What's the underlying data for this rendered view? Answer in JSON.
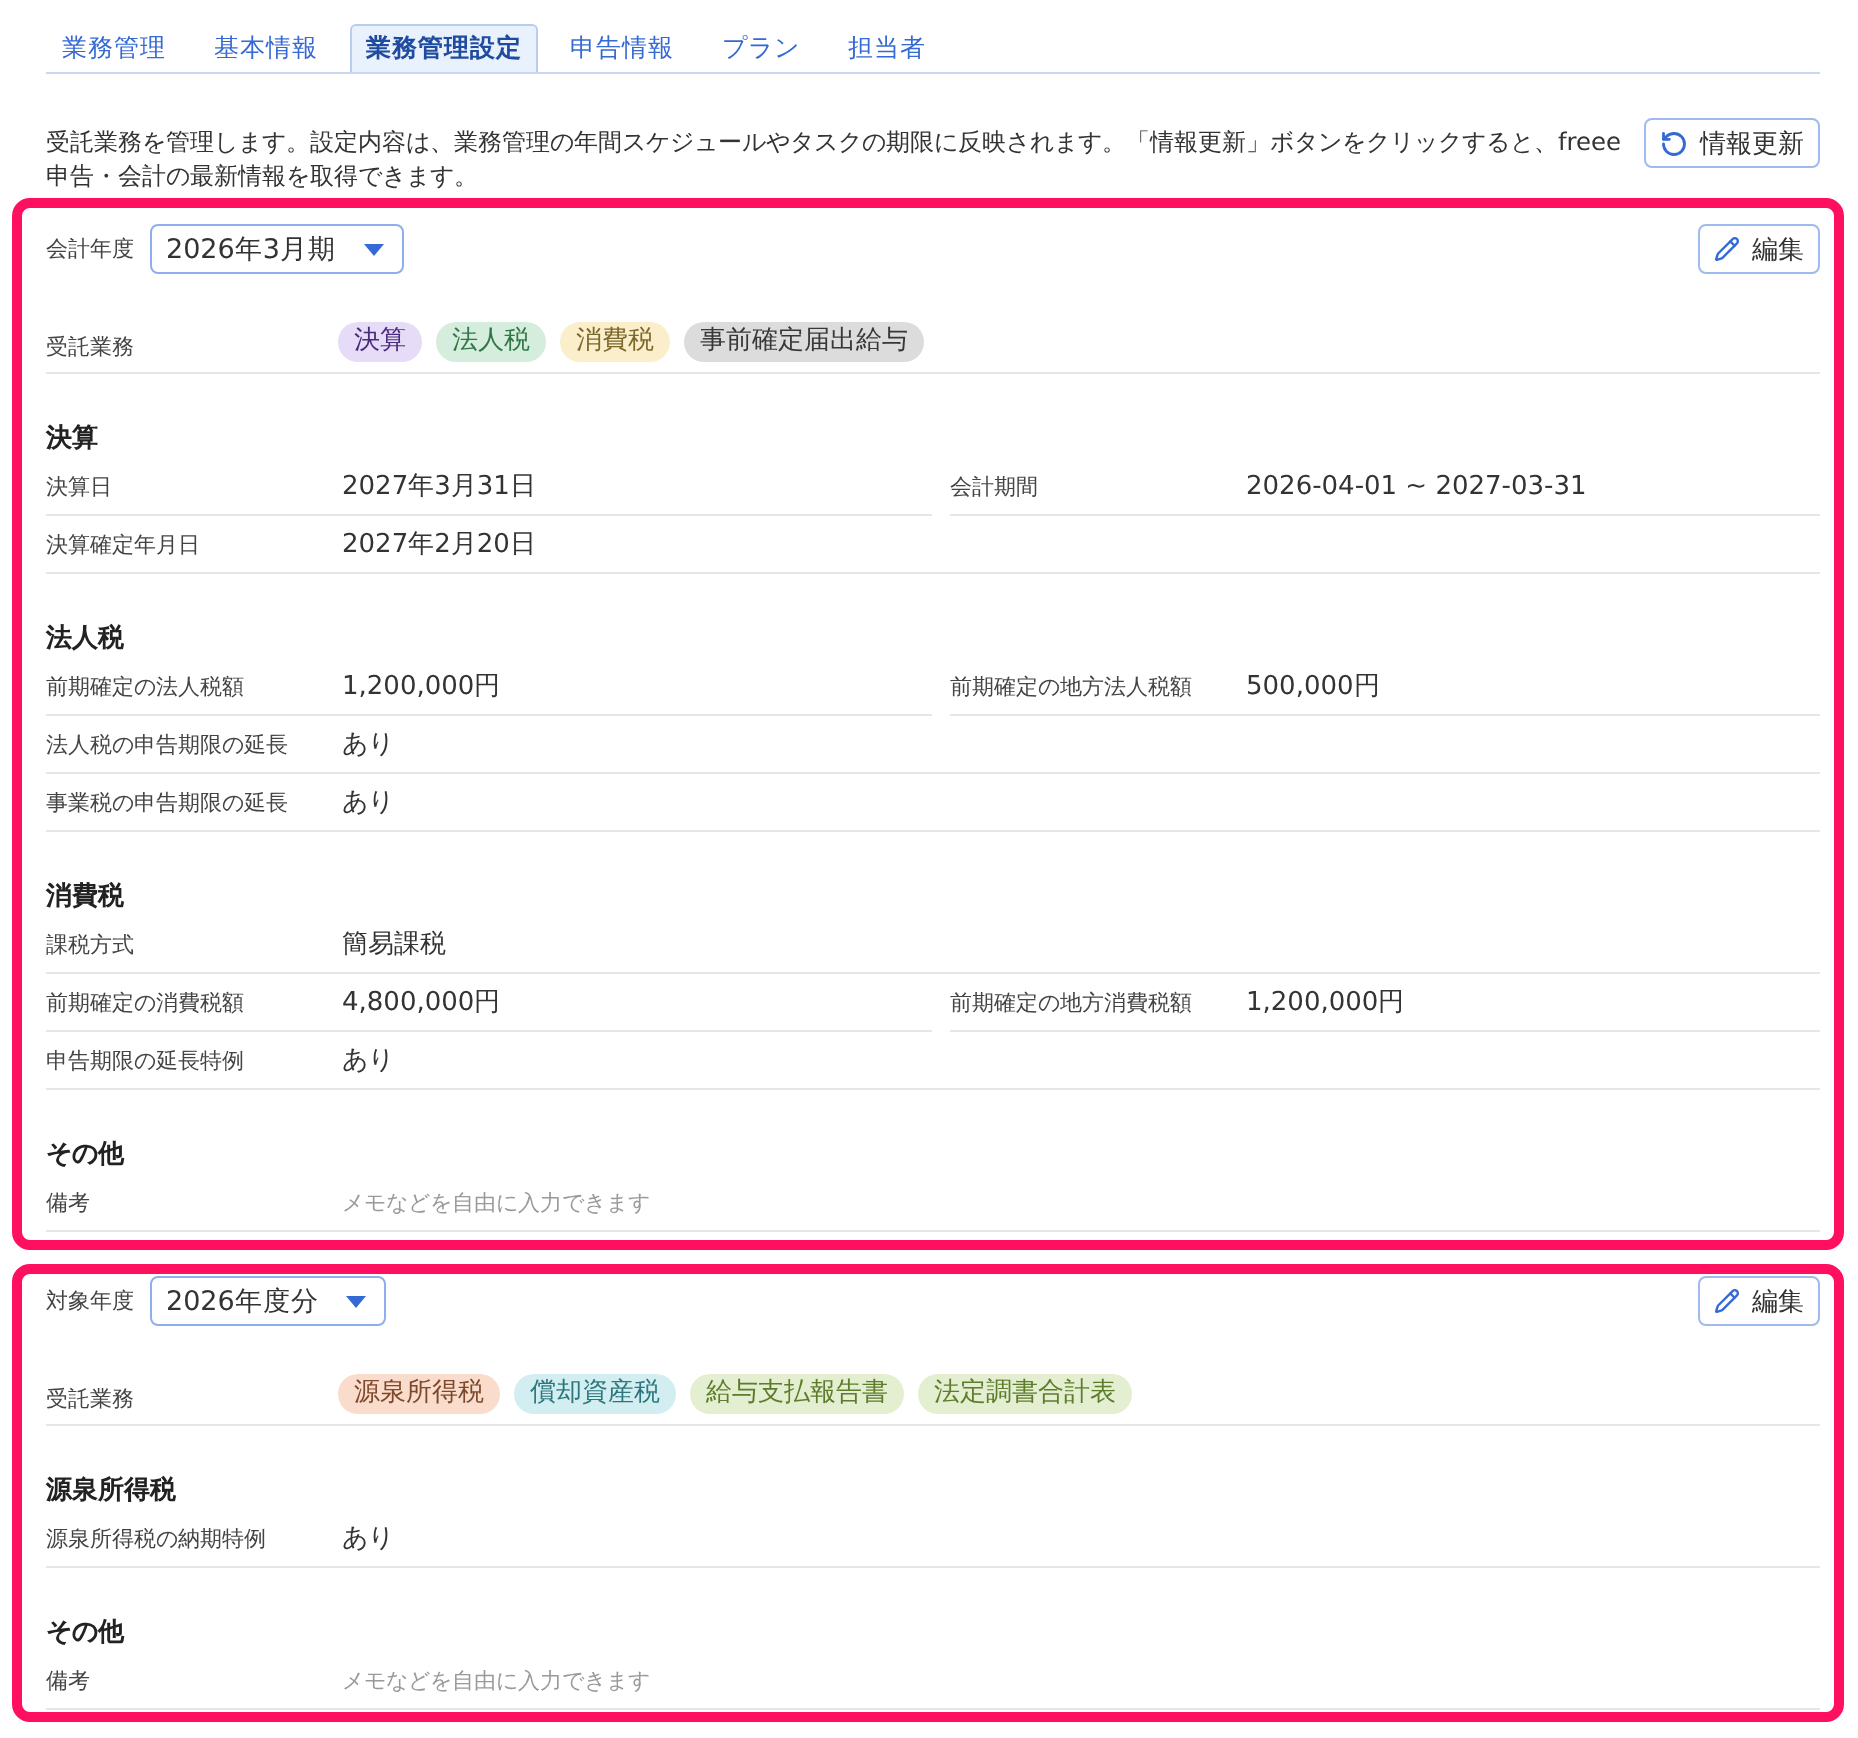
{
  "tabs": [
    {
      "label": "業務管理",
      "selected": false
    },
    {
      "label": "基本情報",
      "selected": false
    },
    {
      "label": "業務管理設定",
      "selected": true
    },
    {
      "label": "申告情報",
      "selected": false
    },
    {
      "label": "プラン",
      "selected": false
    },
    {
      "label": "担当者",
      "selected": false
    }
  ],
  "description": "受託業務を管理します。設定内容は、業務管理の年間スケジュールやタスクの期限に反映されます。「情報更新」ボタンをクリックすると、freee申告・会計の最新情報を取得できます。",
  "refresh_button": {
    "label": "情報更新"
  },
  "panels": [
    {
      "period": {
        "label": "会計年度",
        "value": "2026年3月期"
      },
      "edit_button": {
        "label": "編集"
      },
      "services": {
        "label": "受託業務",
        "tags": [
          {
            "label": "決算",
            "color": "#e6dcf7"
          },
          {
            "label": "法人税",
            "color": "#d5eddc"
          },
          {
            "label": "消費税",
            "color": "#fbefcb"
          },
          {
            "label": "事前確定届出給与",
            "color": "#dcdcdc"
          }
        ]
      },
      "sections": [
        {
          "title": "決算",
          "rows": [
            {
              "fields": [
                {
                  "label": "決算日",
                  "value": "2027年3月31日"
                },
                {
                  "label": "会計期間",
                  "value": "2026-04-01 ~ 2027-03-31"
                }
              ]
            },
            {
              "fields": [
                {
                  "label": "決算確定年月日",
                  "value": "2027年2月20日"
                }
              ]
            }
          ]
        },
        {
          "title": "法人税",
          "rows": [
            {
              "fields": [
                {
                  "label": "前期確定の法人税額",
                  "value": "1,200,000円"
                },
                {
                  "label": "前期確定の地方法人税額",
                  "value": "500,000円"
                }
              ]
            },
            {
              "fields": [
                {
                  "label": "法人税の申告期限の延長",
                  "value": "あり"
                }
              ]
            },
            {
              "fields": [
                {
                  "label": "事業税の申告期限の延長",
                  "value": "あり"
                }
              ]
            }
          ]
        },
        {
          "title": "消費税",
          "rows": [
            {
              "fields": [
                {
                  "label": "課税方式",
                  "value": "簡易課税"
                }
              ]
            },
            {
              "fields": [
                {
                  "label": "前期確定の消費税額",
                  "value": "4,800,000円"
                },
                {
                  "label": "前期確定の地方消費税額",
                  "value": "1,200,000円"
                }
              ]
            },
            {
              "fields": [
                {
                  "label": "申告期限の延長特例",
                  "value": "あり"
                }
              ]
            }
          ]
        },
        {
          "title": "その他",
          "rows": [
            {
              "fields": [
                {
                  "label": "備考",
                  "placeholder": "メモなどを自由に入力できます"
                }
              ]
            }
          ]
        }
      ]
    },
    {
      "period": {
        "label": "対象年度",
        "value": "2026年度分"
      },
      "edit_button": {
        "label": "編集"
      },
      "services": {
        "label": "受託業務",
        "tags": [
          {
            "label": "源泉所得税",
            "color": "#fadccc"
          },
          {
            "label": "償却資産税",
            "color": "#d2eef0"
          },
          {
            "label": "給与支払報告書",
            "color": "#e3efd0"
          },
          {
            "label": "法定調書合計表",
            "color": "#e3efd0"
          }
        ]
      },
      "sections": [
        {
          "title": "源泉所得税",
          "rows": [
            {
              "fields": [
                {
                  "label": "源泉所得税の納期特例",
                  "value": "あり"
                }
              ]
            }
          ]
        },
        {
          "title": "その他",
          "rows": [
            {
              "fields": [
                {
                  "label": "備考",
                  "placeholder": "メモなどを自由に入力できます"
                }
              ]
            }
          ]
        }
      ]
    }
  ]
}
